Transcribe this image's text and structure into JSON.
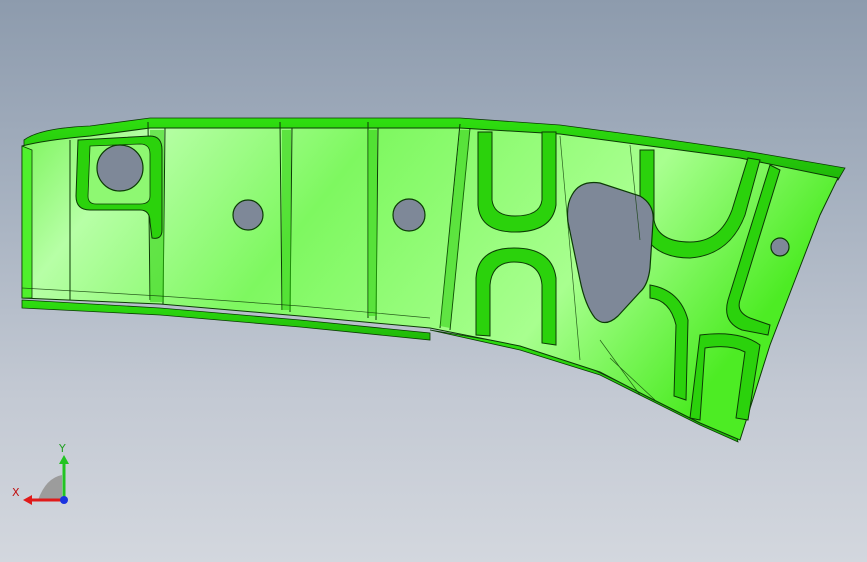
{
  "viewport": {
    "background_top": "#8d9bad",
    "background_bottom": "#d3d7de"
  },
  "model": {
    "part_type": "sheet-metal-bracket",
    "face_color": "#3ee91a",
    "highlight_color": "#b8ffa8",
    "edge_color": "#0c3a05",
    "hole_color": "#7e8898",
    "round_hole_count": 4,
    "cutout_count": 2
  },
  "triad": {
    "x_label": "X",
    "y_label": "Y",
    "x_color": "#e01a1a",
    "y_color": "#22c422",
    "z_color": "#1a33e0",
    "plane_color": "#9c9c9c"
  }
}
